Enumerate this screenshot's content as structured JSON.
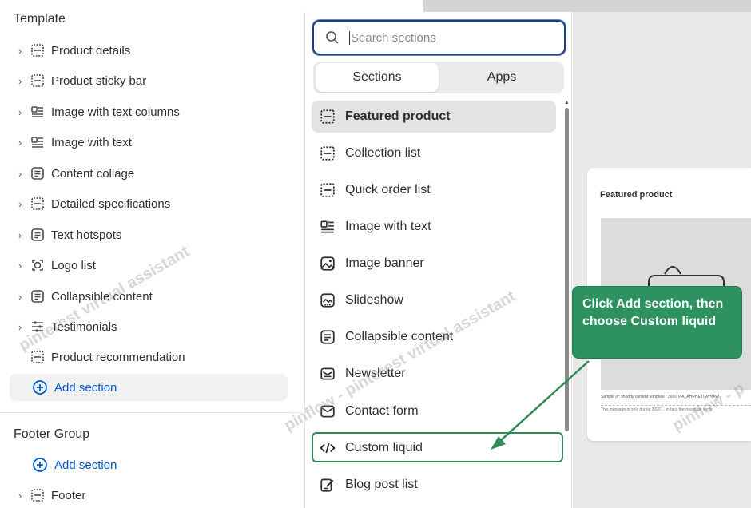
{
  "template": {
    "title": "Template",
    "items": [
      {
        "label": "Product details",
        "icon": "section-icon"
      },
      {
        "label": "Product sticky bar",
        "icon": "section-icon"
      },
      {
        "label": "Image with text columns",
        "icon": "image-text-icon"
      },
      {
        "label": "Image with text",
        "icon": "image-text-icon"
      },
      {
        "label": "Content collage",
        "icon": "text-block-icon"
      },
      {
        "label": "Detailed specifications",
        "icon": "section-icon"
      },
      {
        "label": "Text hotspots",
        "icon": "text-block-icon"
      },
      {
        "label": "Logo list",
        "icon": "logo-icon"
      },
      {
        "label": "Collapsible content",
        "icon": "text-block-icon"
      },
      {
        "label": "Testimonials",
        "icon": "testimonials-icon"
      },
      {
        "label": "Product recommendation",
        "icon": "section-icon"
      }
    ],
    "add_section": "Add section"
  },
  "footer_group": {
    "title": "Footer Group",
    "add_section": "Add section",
    "items": [
      {
        "label": "Footer",
        "icon": "section-icon"
      }
    ]
  },
  "picker": {
    "search_placeholder": "Search sections",
    "tabs": [
      "Sections",
      "Apps"
    ],
    "sections": [
      {
        "label": "Featured product",
        "icon": "section-icon"
      },
      {
        "label": "Collection list",
        "icon": "section-icon"
      },
      {
        "label": "Quick order list",
        "icon": "section-icon"
      },
      {
        "label": "Image with text",
        "icon": "image-text-icon"
      },
      {
        "label": "Image banner",
        "icon": "image-icon"
      },
      {
        "label": "Slideshow",
        "icon": "slideshow-icon"
      },
      {
        "label": "Collapsible content",
        "icon": "text-block-icon"
      },
      {
        "label": "Newsletter",
        "icon": "newsletter-icon"
      },
      {
        "label": "Contact form",
        "icon": "mail-icon"
      },
      {
        "label": "Custom liquid",
        "icon": "code-icon"
      },
      {
        "label": "Blog post list",
        "icon": "blog-icon"
      }
    ]
  },
  "preview": {
    "card_title": "Featured product",
    "line1": "Sample of: shoddy content template / 3000 V/A_AHRHEJTWHIAW",
    "line2": "This message in only during 3000 ... in face the message verify"
  },
  "callout": {
    "text": "Click Add section, then choose Custom liquid"
  },
  "watermarks": [
    "pinterest virtual assistant",
    "pinflow - pinterest virtual assistant",
    "pinflow - p"
  ],
  "colors": {
    "accent_blue": "#005bd3",
    "callout_green": "#2e9160",
    "highlight_border": "#2e8b57"
  }
}
